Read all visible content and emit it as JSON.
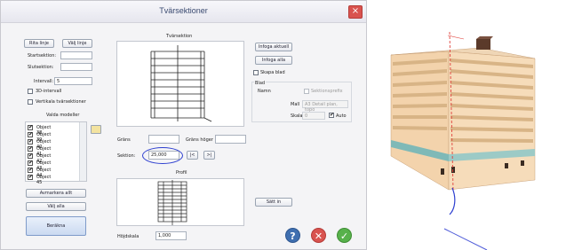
{
  "dialog": {
    "title": "Tvärsektioner",
    "close_glyph": "×",
    "left": {
      "draw_line": "Rita linje",
      "choose_line": "Välj linje",
      "start_label": "Startsektion:",
      "end_label": "Slutsektion:",
      "interval_label": "Intervall:",
      "interval_value": "5",
      "opt_3d": "3D-intervall",
      "opt_vertical": "Vertikala tvärsektioner",
      "models_title": "Valda modeller",
      "models": [
        "Object 38",
        "Object 39",
        "Object 40",
        "Object 41",
        "Object 42",
        "Object 43",
        "Object 44",
        "Object 45"
      ],
      "deselect_all": "Avmarkera allt",
      "select_all": "Välj alla",
      "calculate": "Beräkna"
    },
    "center": {
      "section_title": "Tvärsektion",
      "grans_label": "Gräns",
      "grans_hoger_label": "Gräns höger",
      "sektion_label": "Sektion:",
      "sektion_value": "25,000",
      "prev": "|<",
      "next": ">|",
      "profile_title": "Profil",
      "height_scale_label": "Höjdskala",
      "height_scale_value": "1,000"
    },
    "right": {
      "insert_current": "Infoga aktuell",
      "insert_all": "Infoga alla",
      "create_sheet": "Skapa blad",
      "sheet_group": "Blad",
      "name_label": "Namn",
      "section_prefix": "Sektionsprefix",
      "template_label": "Mall",
      "template_value": "A3 Detail plan, topo",
      "scale_label": "Skala",
      "scale_value": "0",
      "auto_label": "Auto",
      "set_in": "Sätt in"
    },
    "footer": {
      "help_glyph": "?",
      "cancel_glyph": "✕",
      "ok_glyph": "✓"
    }
  },
  "colors": {
    "accent_blue": "#3f6fb0",
    "section_circle": "#2d3fd0",
    "cancel_red": "#d9534f",
    "ok_green": "#57b14b",
    "building_wall": "#f3d3ac",
    "building_band": "#d8b486",
    "section_line": "#e0413b"
  }
}
